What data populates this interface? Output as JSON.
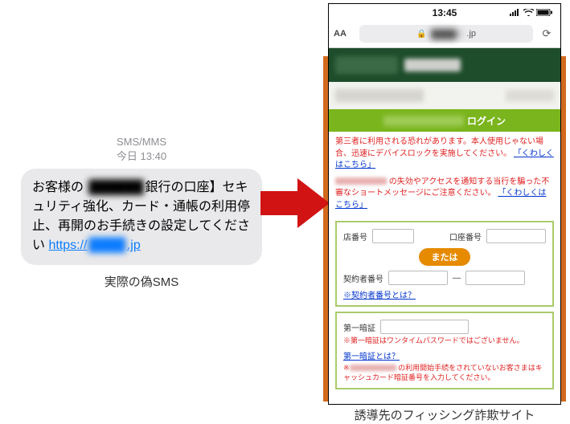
{
  "sms": {
    "meta_line1": "SMS/MMS",
    "meta_line2": "今日 13:40",
    "body_prefix": "お客様の ",
    "body_blurred": "██████",
    "body_mid": "銀行の口座】セキュリティ強化、カード・通帳の利用停止、再開のお手続きの設定してください ",
    "link_prefix": "https://",
    "link_blurred": "████",
    "link_suffix": ".jp",
    "caption": "実際の偽SMS"
  },
  "phone": {
    "status_time": "13:45",
    "url_lock_label": "lock",
    "url_blurred": "████",
    "url_suffix": ".jp",
    "login_title_tail": "ログイン",
    "warn1_a": "第三者に利用される恐れがあります。本人使用じゃない場合、迅速にデバイスロックを実施してください。",
    "warn1_link": "「くわしくはこちら」",
    "warn2_b": "の失効やアクセスを通知する当行を騙った不審なショートメッセージにご注意ください。",
    "warn2_link": "「くわしくはこちら」",
    "label_store": "店番号",
    "label_account": "口座番号",
    "or_label": "または",
    "label_contract": "契約者番号",
    "dash": "—",
    "help_contract": "※契約者番号とは？",
    "label_pin": "第一暗証",
    "pin_note1": "※第一暗証はワンタイムパスワードではございません。",
    "help_pin": "第一暗証とは？",
    "pin_note2_tail": "の利用開始手続をされていないお客さまはキャッシュカード暗証番号を入力してください。",
    "caption": "誘導先のフィッシング詐欺サイト"
  },
  "colors": {
    "green_header": "#1e4d2b",
    "login_bar": "#7ab51d",
    "or_pill": "#e68a00",
    "warn_red": "#e02020",
    "arrow": "#d11313"
  }
}
